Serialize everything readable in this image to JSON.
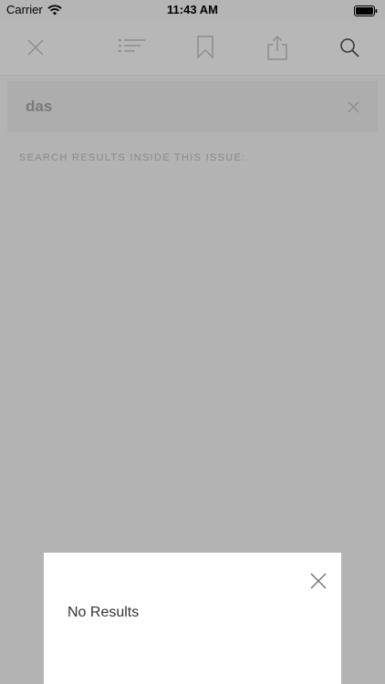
{
  "status_bar": {
    "carrier": "Carrier",
    "time": "11:43 AM",
    "icons": [
      "wifi-icon",
      "battery-icon"
    ]
  },
  "toolbar": {
    "buttons": [
      {
        "name": "close",
        "icon": "close-icon"
      },
      {
        "name": "table-of-contents",
        "icon": "list-icon"
      },
      {
        "name": "bookmark",
        "icon": "bookmark-icon"
      },
      {
        "name": "share",
        "icon": "share-icon"
      },
      {
        "name": "search",
        "icon": "search-icon"
      }
    ]
  },
  "search": {
    "query": "das",
    "clear_icon": "close-icon"
  },
  "results": {
    "heading": "SEARCH RESULTS INSIDE THIS ISSUE:"
  },
  "modal": {
    "message": "No Results",
    "close_icon": "close-icon"
  },
  "colors": {
    "overlay": "#b3b3b3",
    "toolbar_icon": "#8e8e8e",
    "search_icon": "#3a3a3a",
    "modal_bg": "#ffffff"
  }
}
